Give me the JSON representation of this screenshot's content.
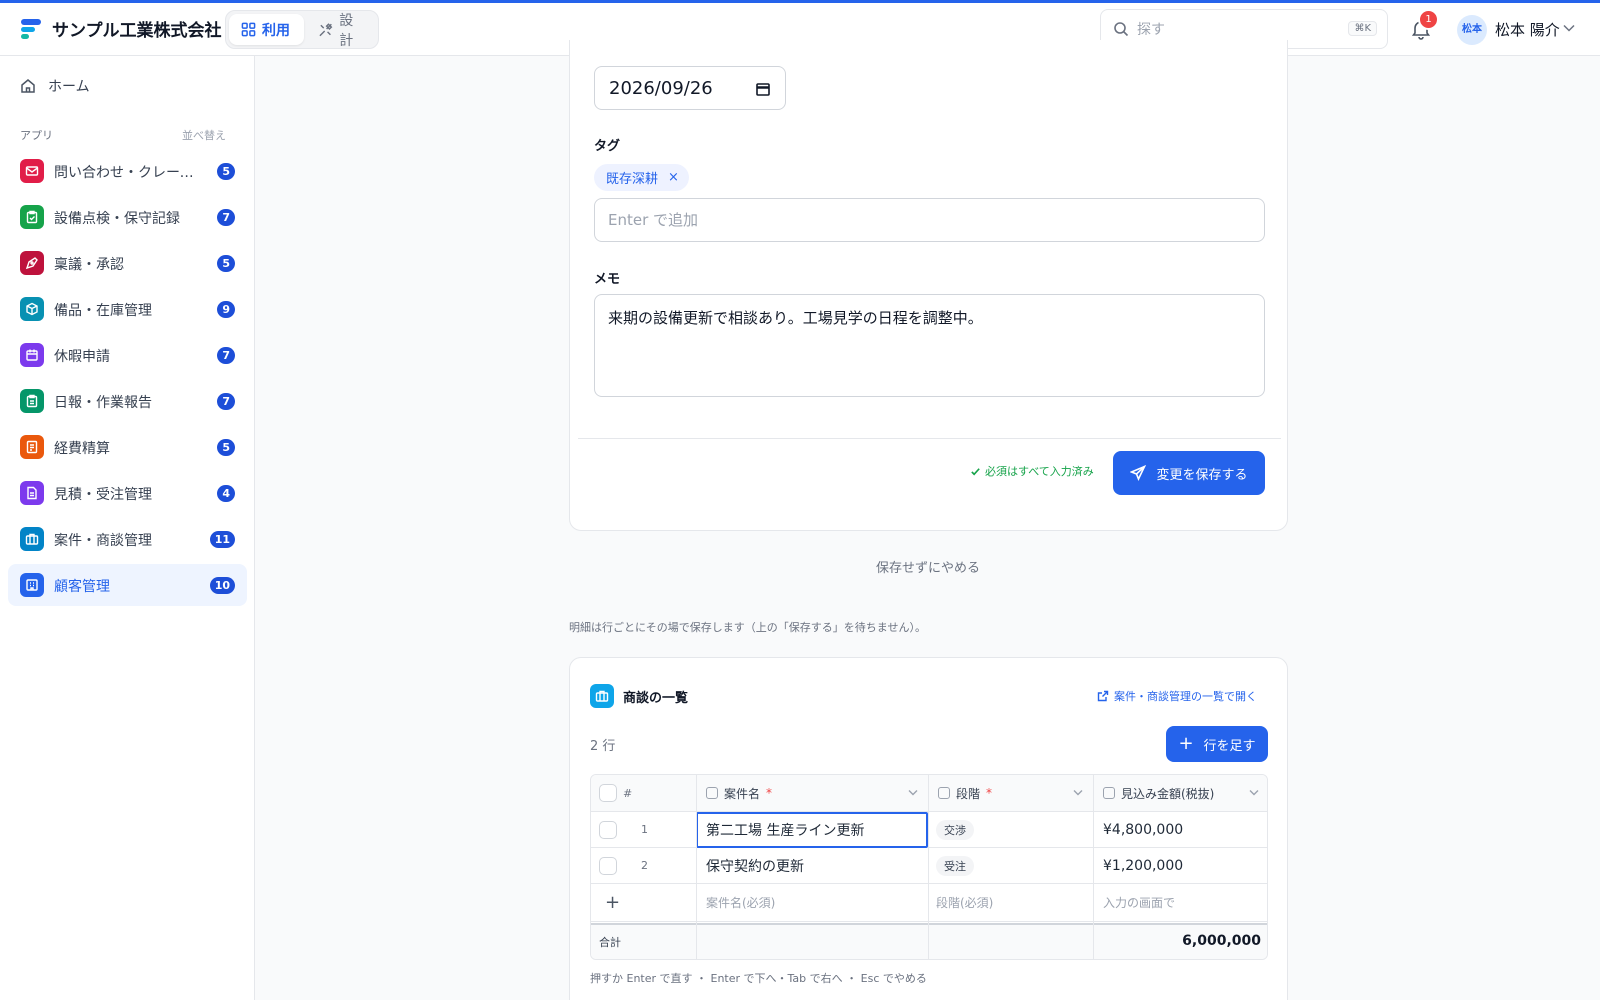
{
  "app": {
    "company": "サンプル工業株式会社"
  },
  "modes": {
    "use": "利用",
    "design": "設計"
  },
  "search": {
    "placeholder": "探す",
    "shortcut": "⌘K"
  },
  "notifications": {
    "count": "1"
  },
  "user": {
    "avatar": "松本",
    "name": "松本 陽介"
  },
  "sidebar": {
    "home": "ホーム",
    "apps_heading": "アプリ",
    "sort_label": "並べ替え",
    "items": [
      {
        "label": "問い合わせ・クレーム管理",
        "count": "5",
        "color": "#e11d48",
        "icon": "mail-icon"
      },
      {
        "label": "設備点検・保守記録",
        "count": "7",
        "color": "#16a34a",
        "icon": "clipboard-check-icon"
      },
      {
        "label": "稟議・承認",
        "count": "5",
        "color": "#be123c",
        "icon": "pen-icon"
      },
      {
        "label": "備品・在庫管理",
        "count": "9",
        "color": "#0891b2",
        "icon": "box-icon"
      },
      {
        "label": "休暇申請",
        "count": "7",
        "color": "#7c3aed",
        "icon": "calendar-icon"
      },
      {
        "label": "日報・作業報告",
        "count": "7",
        "color": "#059669",
        "icon": "clipboard-icon"
      },
      {
        "label": "経費精算",
        "count": "5",
        "color": "#ea580c",
        "icon": "receipt-icon"
      },
      {
        "label": "見積・受注管理",
        "count": "4",
        "color": "#7c3aed",
        "icon": "document-icon"
      },
      {
        "label": "案件・商談管理",
        "count": "11",
        "color": "#0284c7",
        "icon": "briefcase-icon"
      },
      {
        "label": "顧客管理",
        "count": "10",
        "color": "#2563eb",
        "icon": "building-icon"
      }
    ]
  },
  "form": {
    "date_value": "2026/09/26",
    "tags_label": "タグ",
    "tags": [
      "既存深耕"
    ],
    "tag_remove": "×",
    "tag_input_placeholder": "Enter で追加",
    "memo_label": "メモ",
    "memo_value": "来期の設備更新で相談あり。工場見学の日程を調整中。",
    "required_status": "必須はすべて入力済み",
    "save_button": "変更を保存する"
  },
  "cancel_link": "保存せずにやめる",
  "detail_note": "明細は行ごとにその場で保存します（上の「保存する」を待ちません）。",
  "deals": {
    "title": "商談の一覧",
    "open_link": "案件・商談管理の一覧で開く",
    "row_count": "2 行",
    "add_row_button": "行を足す",
    "columns": {
      "index": "#",
      "name": "案件名",
      "stage": "段階",
      "amount": "見込み金額(税抜)",
      "required_mark": "*"
    },
    "rows": [
      {
        "index": "1",
        "name": "第二工場 生産ライン更新",
        "stage": "交渉",
        "amount": "¥4,800,000"
      },
      {
        "index": "2",
        "name": "保守契約の更新",
        "stage": "受注",
        "amount": "¥1,200,000"
      }
    ],
    "new_row": {
      "add": "+",
      "name_placeholder": "案件名(必須)",
      "stage_placeholder": "段階(必須)",
      "amount_placeholder": "入力の画面で"
    },
    "total_label": "合計",
    "total_value": "6,000,000",
    "hint": "押すか Enter で直す ・ Enter で下へ・Tab で右へ ・ Esc でやめる"
  }
}
